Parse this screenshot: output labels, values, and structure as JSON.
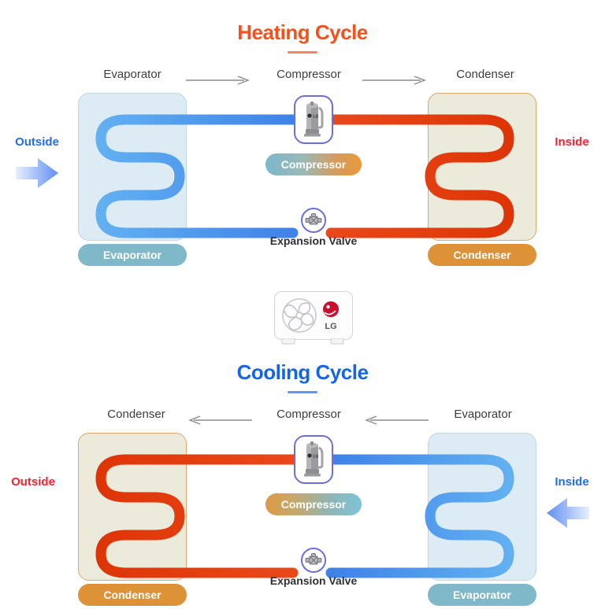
{
  "page": {
    "brand": "LG",
    "colors": {
      "heat_title": "#f4511e",
      "cool_title": "#1565e8",
      "hot_pipe": "#e03a10",
      "cold_pipe": "#4a9df0",
      "evaporator_box": "#dcebf4",
      "condenser_box": "#eceadb",
      "evaporator_pill": "#7fb8c9",
      "condenser_pill": "#dd9238",
      "outside_blue": "#1f6dea",
      "inside_red": "#f5222d",
      "badge_border": "#6b6fd6",
      "arrow_gray": "#8a8a90"
    }
  },
  "heating": {
    "title": "Heating Cycle",
    "flow": [
      {
        "label": "Evaporator"
      },
      {
        "label": "Compressor"
      },
      {
        "label": "Condenser"
      }
    ],
    "arrow_direction": "right",
    "left_side": {
      "label": "Outside",
      "color": "#1f6dea",
      "arrow": "right"
    },
    "right_side": {
      "label": "Inside",
      "color": "#f5222d",
      "arrow": "none"
    },
    "left_unit": {
      "pill": "Evaporator",
      "type": "evaporator",
      "coil": "cold"
    },
    "right_unit": {
      "pill": "Condenser",
      "type": "condenser",
      "coil": "hot"
    },
    "compressor_pill": "Compressor",
    "valve_caption": "Expansion Valve",
    "compressor_icon": "compressor-icon",
    "valve_icon": "expansion-valve-icon"
  },
  "cooling": {
    "title": "Cooling Cycle",
    "flow": [
      {
        "label": "Condenser"
      },
      {
        "label": "Compressor"
      },
      {
        "label": "Evaporator"
      }
    ],
    "arrow_direction": "left",
    "left_side": {
      "label": "Outside",
      "color": "#f5222d",
      "arrow": "none"
    },
    "right_side": {
      "label": "Inside",
      "color": "#1f6dea",
      "arrow": "left"
    },
    "left_unit": {
      "pill": "Condenser",
      "type": "condenser",
      "coil": "hot"
    },
    "right_unit": {
      "pill": "Evaporator",
      "type": "evaporator",
      "coil": "cold"
    },
    "compressor_pill": "Compressor",
    "valve_caption": "Expansion Valve",
    "compressor_icon": "compressor-icon",
    "valve_icon": "expansion-valve-icon"
  },
  "outdoor_unit": {
    "brand": "LG",
    "icon": "outdoor-unit-fan-icon"
  }
}
